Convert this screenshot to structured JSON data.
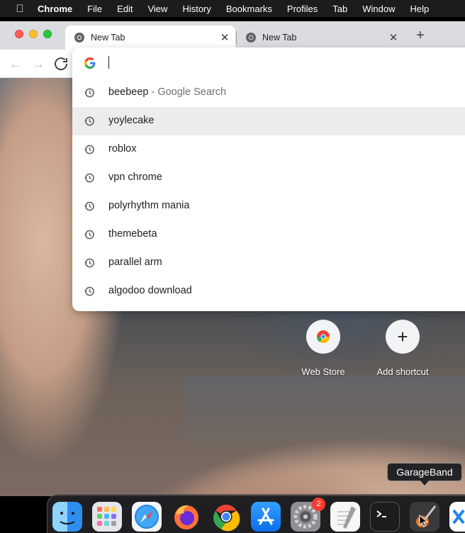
{
  "menubar": {
    "app_name": "Chrome",
    "items": [
      "File",
      "Edit",
      "View",
      "History",
      "Bookmarks",
      "Profiles",
      "Tab",
      "Window",
      "Help"
    ]
  },
  "tabs": [
    {
      "title": "New Tab",
      "active": true
    },
    {
      "title": "New Tab",
      "active": false
    }
  ],
  "omnibox": {
    "value": "",
    "suggestions": [
      {
        "text": "beebeep",
        "suffix": " - Google Search",
        "selected": false
      },
      {
        "text": "yoylecake",
        "suffix": "",
        "selected": true
      },
      {
        "text": "roblox",
        "suffix": "",
        "selected": false
      },
      {
        "text": "vpn chrome",
        "suffix": "",
        "selected": false
      },
      {
        "text": "polyrhythm mania",
        "suffix": "",
        "selected": false
      },
      {
        "text": "themebeta",
        "suffix": "",
        "selected": false
      },
      {
        "text": "parallel arm",
        "suffix": "",
        "selected": false
      },
      {
        "text": "algodoo download",
        "suffix": "",
        "selected": false
      }
    ]
  },
  "shortcuts": [
    {
      "label": "Web Store",
      "icon": "web-store-icon"
    },
    {
      "label": "Add shortcut",
      "icon": "plus-icon"
    }
  ],
  "dock": {
    "tooltip": "GarageBand",
    "settings_badge": "2",
    "apps": [
      "Finder",
      "Launchpad",
      "Safari",
      "Firefox",
      "Chrome",
      "App Store",
      "System Preferences",
      "TextEdit",
      "Terminal",
      "GarageBand",
      "Xcode"
    ]
  },
  "colors": {
    "menubar_bg": "#1c1c1e",
    "tabstrip_bg": "#dadce0",
    "selected_suggestion_bg": "#ececec",
    "badge_red": "#ff3b30"
  }
}
